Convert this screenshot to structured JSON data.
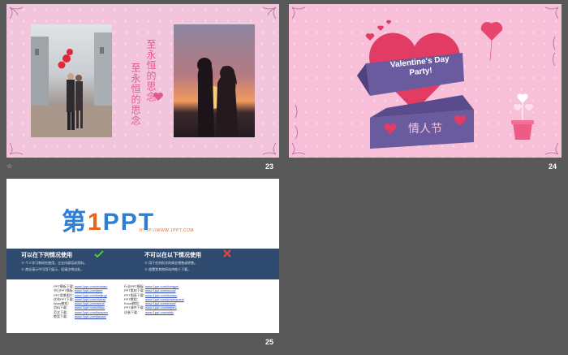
{
  "slides": [
    {
      "number": "23",
      "vertical_text_1": "至永恒的思念",
      "vertical_text_2": "至永恒的思念",
      "star": "☆"
    },
    {
      "number": "24",
      "banner_text": "Valentine's Day Party!",
      "subtitle": "情人节",
      "star": ""
    },
    {
      "number": "25",
      "logo_prefix": "第",
      "logo_one": "1",
      "logo_suffix": "PPT",
      "logo_url": "HTTP://WWW.1PPT.COM",
      "allowed_heading": "可以在下列情况使用",
      "disallowed_heading": "不可以在以下情况使用",
      "allowed_lines": [
        "※ 个人学习和研究使用，企业内部培训资料。",
        "※ 商业演示中可用于展示，但请注明出处。"
      ],
      "disallowed_lines": [
        "※ 用于任何形式的商业销售或转售。",
        "※ 放置到其他网站供他人下载。"
      ],
      "links_left": [
        [
          "PPT模板下载：",
          "www.1ppt.com/moban/"
        ],
        [
          "节日PPT模板：",
          "www.1ppt.com/jieri/"
        ],
        [
          "PPT背景图片：",
          "www.1ppt.com/beijing/"
        ],
        [
          "优秀PPT下载：",
          "www.1ppt.com/xiazai/"
        ],
        [
          "Word教程：",
          "www.1ppt.com/word/"
        ],
        [
          "资料下载：",
          "www.1ppt.com/ziliao/"
        ],
        [
          "范文下载：",
          "www.1ppt.com/fanwen/"
        ],
        [
          "教案下载：",
          "www.1ppt.com/jiaoan/"
        ]
      ],
      "links_right": [
        [
          "行业PPT模板：",
          "www.1ppt.com/hangye/"
        ],
        [
          "PPT素材下载：",
          "www.1ppt.com/sucai/"
        ],
        [
          "PPT图表下载：",
          "www.1ppt.com/tubiao/"
        ],
        [
          "PPT教程：",
          "www.1ppt.com/powerpoint/"
        ],
        [
          "Excel教程：",
          "www.1ppt.com/excel/"
        ],
        [
          "PPT课件下载：",
          "www.1ppt.com/kejian/"
        ],
        [
          "试卷下载：",
          "www.1ppt.com/shiti/"
        ]
      ]
    }
  ],
  "colors": {
    "background": "#595959",
    "heart": "#e23c64",
    "ribbon": "#6a5a9e",
    "accent_pink": "#e2568f"
  }
}
